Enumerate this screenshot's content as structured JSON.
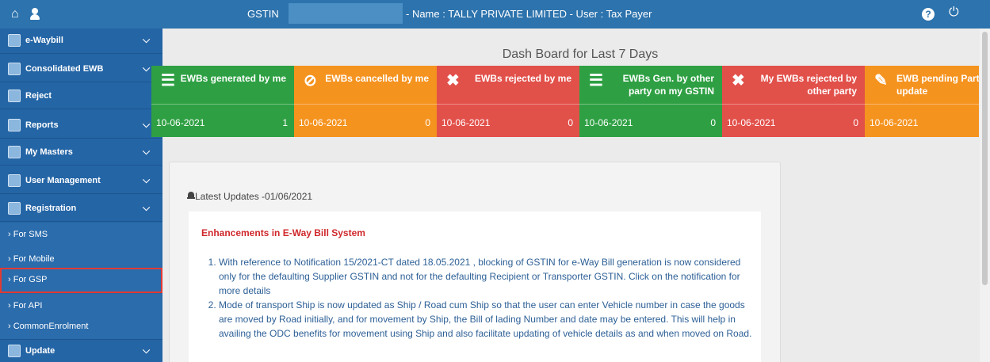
{
  "topbar": {
    "home_icon": "home-icon",
    "user_icon": "user-icon",
    "gstin_label": "GSTIN",
    "gstin_value": "",
    "info": "- Name : TALLY PRIVATE LIMITED - User : Tax Payer",
    "help_icon": "help-icon",
    "power_icon": "power-icon"
  },
  "sidebar": {
    "items": [
      {
        "label": "e-Waybill",
        "icon": "document-icon",
        "has_chevron": true
      },
      {
        "label": "Consolidated EWB",
        "icon": "document-icon",
        "has_chevron": true
      },
      {
        "label": "Reject",
        "icon": "reject-icon",
        "has_chevron": false
      },
      {
        "label": "Reports",
        "icon": "reports-icon",
        "has_chevron": true
      },
      {
        "label": "My Masters",
        "icon": "masters-icon",
        "has_chevron": true
      },
      {
        "label": "User Management",
        "icon": "users-icon",
        "has_chevron": true
      },
      {
        "label": "Registration",
        "icon": "registration-icon",
        "has_chevron": true
      },
      {
        "label": "› For SMS"
      },
      {
        "label": "› For Mobile"
      },
      {
        "label": "› For GSP",
        "selected": true
      },
      {
        "label": "› For API"
      },
      {
        "label": "› CommonEnrolment"
      },
      {
        "label": "Update",
        "icon": "update-icon",
        "has_chevron": true
      }
    ]
  },
  "dashboard": {
    "title": "Dash Board for Last 7 Days",
    "tiles": [
      {
        "title": "EWBs generated by me",
        "date": "10-06-2021",
        "count": "1",
        "icon": "list-icon",
        "color": "#2ea043"
      },
      {
        "title": "EWBs cancelled by me",
        "date": "10-06-2021",
        "count": "0",
        "icon": "cancel-icon",
        "color": "#f5931f"
      },
      {
        "title": "EWBs rejected by me",
        "date": "10-06-2021",
        "count": "0",
        "icon": "close-icon",
        "color": "#e2504a"
      },
      {
        "title": "EWBs Gen. by other party on my GSTIN",
        "date": "10-06-2021",
        "count": "0",
        "icon": "list-icon",
        "color": "#2ea043"
      },
      {
        "title": "My EWBs rejected by other party",
        "date": "10-06-2021",
        "count": "0",
        "icon": "close-icon",
        "color": "#e2504a"
      },
      {
        "title": "EWB pending Part-B update",
        "date": "10-06-2021",
        "count": "",
        "icon": "edit-icon",
        "color": "#f5931f"
      }
    ]
  },
  "updates": {
    "header": "Latest Updates -01/06/2021",
    "heading": "Enhancements in E-Way Bill System",
    "items": [
      "With reference to Notification 15/2021-CT dated 18.05.2021 , blocking of GSTIN for e-Way Bill generation is now considered only for the defaulting Supplier GSTIN and not for the defaulting Recipient or Transporter GSTIN. Click on the notification for more details",
      "Mode of transport Ship is now updated as Ship / Road cum Ship so that the user can enter Vehicle number in case the goods are moved by Road initially, and for movement by Ship, the Bill of lading Number and date may be entered. This will help in availing the ODC benefits for movement using Ship and also facilitate updating of vehicle details as and when moved on Road."
    ]
  }
}
